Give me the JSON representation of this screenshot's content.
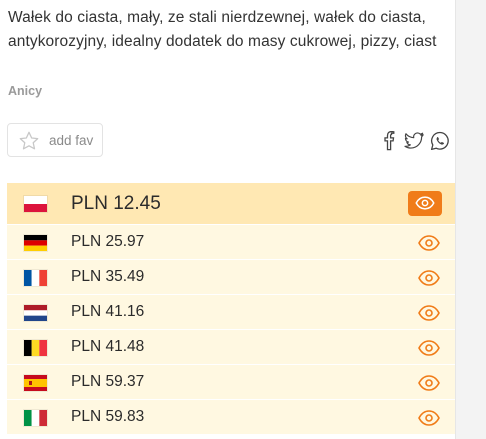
{
  "product": {
    "title": "Wałek do ciasta, mały, ze stali nierdzewnej, wałek do ciasta, antykorozyjny, idealny dodatek do masy cukrowej, pizzy, ciast",
    "brand": "Anicy"
  },
  "actions": {
    "fav_label": "add fav",
    "social": [
      "facebook-icon",
      "twitter-icon",
      "whatsapp-icon"
    ]
  },
  "colors": {
    "accent": "#f07c19",
    "best_row_bg": "#ffe8b3",
    "row_bg": "#fff8e1"
  },
  "prices": [
    {
      "country": "Poland",
      "flag": "pl",
      "price": "PLN 12.45",
      "best": true
    },
    {
      "country": "Germany",
      "flag": "de",
      "price": "PLN 25.97",
      "best": false
    },
    {
      "country": "France",
      "flag": "fr",
      "price": "PLN 35.49",
      "best": false
    },
    {
      "country": "Netherlands",
      "flag": "nl",
      "price": "PLN 41.16",
      "best": false
    },
    {
      "country": "Belgium",
      "flag": "be",
      "price": "PLN 41.48",
      "best": false
    },
    {
      "country": "Spain",
      "flag": "es",
      "price": "PLN 59.37",
      "best": false
    },
    {
      "country": "Italy",
      "flag": "it",
      "price": "PLN 59.83",
      "best": false
    }
  ]
}
